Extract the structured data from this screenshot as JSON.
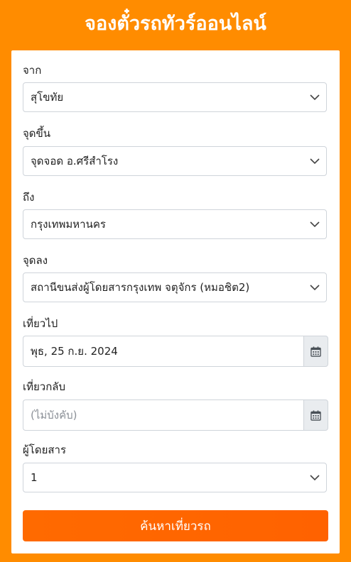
{
  "header": {
    "title": "จองตั๋วรถทัวร์ออนไลน์"
  },
  "form": {
    "from": {
      "label": "จาก",
      "value": "สุโขทัย"
    },
    "pickup": {
      "label": "จุดขึ้น",
      "value": "จุดจอด อ.ศรีสำโรง"
    },
    "to": {
      "label": "ถึง",
      "value": "กรุงเทพมหานคร"
    },
    "dropoff": {
      "label": "จุดลง",
      "value": "สถานีขนส่งผู้โดยสารกรุงเทพ จตุจักร (หมอชิต2)"
    },
    "depart": {
      "label": "เที่ยวไป",
      "value": "พุธ, 25 ก.ย. 2024"
    },
    "return": {
      "label": "เที่ยวกลับ",
      "placeholder": "(ไม่บังคับ)"
    },
    "passengers": {
      "label": "ผู้โดยสาร",
      "value": "1"
    },
    "search_label": "ค้นหาเที่ยวรถ"
  },
  "icons": {
    "select": "chevron-down-icon",
    "date": "calendar-icon"
  },
  "colors": {
    "background": "#ff8c00",
    "button": "#ff6a00",
    "card": "#ffffff"
  }
}
